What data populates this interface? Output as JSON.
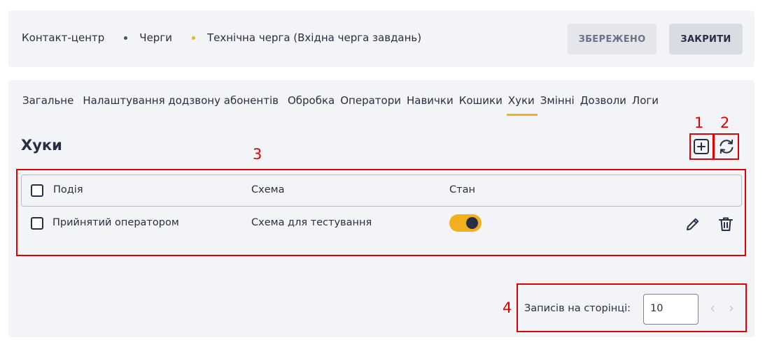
{
  "header": {
    "breadcrumb": [
      "Контакт-центр",
      "Черги",
      "Технічна черга (Вхідна черга завдань)"
    ],
    "saved_label": "ЗБЕРЕЖЕНО",
    "close_label": "ЗАКРИТИ"
  },
  "tabs": [
    {
      "label": "Загальне"
    },
    {
      "label": "Налаштування додзвону абонентів"
    },
    {
      "label": "Обробка"
    },
    {
      "label": "Оператори"
    },
    {
      "label": "Навички"
    },
    {
      "label": "Кошики"
    },
    {
      "label": "Хуки",
      "active": true
    },
    {
      "label": "Змінні"
    },
    {
      "label": "Дозволи"
    },
    {
      "label": "Логи"
    }
  ],
  "section": {
    "title": "Хуки",
    "add_icon": "add-square-icon",
    "refresh_icon": "refresh-icon"
  },
  "table": {
    "columns": [
      "Подія",
      "Схема",
      "Стан"
    ],
    "rows": [
      {
        "event": "Прийнятий оператором",
        "schema": "Схема для тестування",
        "enabled": true
      }
    ]
  },
  "pagination": {
    "label": "Записів на сторінці:",
    "value": "10"
  },
  "annotations": [
    "1",
    "2",
    "3",
    "4"
  ],
  "colors": {
    "accent": "#f2b01e",
    "annotation": "#e10000",
    "text": "#2b2d42",
    "panel": "#f3f4f8"
  }
}
